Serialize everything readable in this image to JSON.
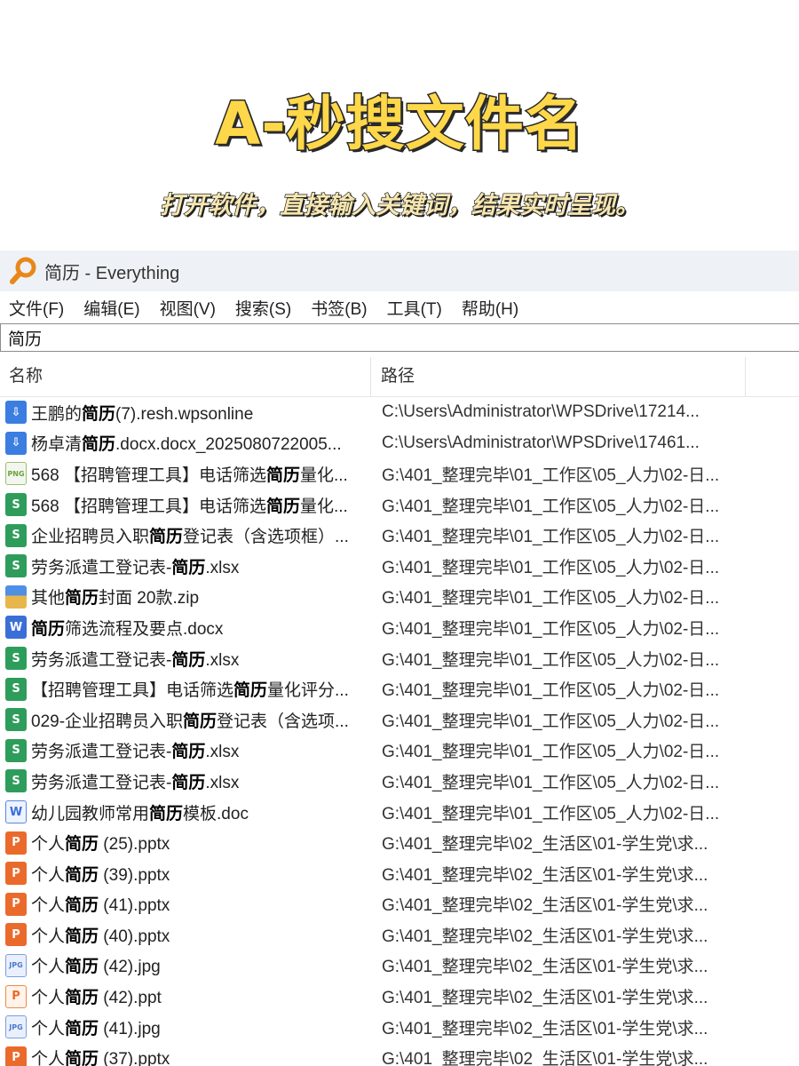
{
  "headline": "A-秒搜文件名",
  "subline": "打开软件，直接输入关键词，结果实时呈现。",
  "window": {
    "title": "简历 - Everything",
    "menu": [
      "文件(F)",
      "编辑(E)",
      "视图(V)",
      "搜索(S)",
      "书签(B)",
      "工具(T)",
      "帮助(H)"
    ],
    "search_value": "简历",
    "columns": {
      "name": "名称",
      "path": "路径"
    },
    "rows": [
      {
        "icon": "download-file-icon",
        "name": "王鹏的简历(7).resh.wpsonline",
        "path": "C:\\Users\\Administrator\\WPSDrive\\17214..."
      },
      {
        "icon": "download-file-icon",
        "name": "杨卓清简历.docx.docx_2025080722005...",
        "path": "C:\\Users\\Administrator\\WPSDrive\\17461..."
      },
      {
        "icon": "png-file-icon",
        "name": "568 【招聘管理工具】电话筛选简历量化...",
        "path": "G:\\401_整理完毕\\01_工作区\\05_人力\\02-日..."
      },
      {
        "icon": "xlsx-file-icon",
        "name": "568 【招聘管理工具】电话筛选简历量化...",
        "path": "G:\\401_整理完毕\\01_工作区\\05_人力\\02-日..."
      },
      {
        "icon": "xlsx-file-icon",
        "name": "企业招聘员入职简历登记表（含选项框）...",
        "path": "G:\\401_整理完毕\\01_工作区\\05_人力\\02-日..."
      },
      {
        "icon": "xlsx-file-icon",
        "name": "劳务派遣工登记表-简历.xlsx",
        "path": "G:\\401_整理完毕\\01_工作区\\05_人力\\02-日..."
      },
      {
        "icon": "zip-file-icon",
        "name": "其他简历封面 20款.zip",
        "path": "G:\\401_整理完毕\\01_工作区\\05_人力\\02-日..."
      },
      {
        "icon": "docx-file-icon",
        "name": "简历筛选流程及要点.docx",
        "path": "G:\\401_整理完毕\\01_工作区\\05_人力\\02-日..."
      },
      {
        "icon": "xlsx-file-icon",
        "name": "劳务派遣工登记表-简历.xlsx",
        "path": "G:\\401_整理完毕\\01_工作区\\05_人力\\02-日..."
      },
      {
        "icon": "xlsx-file-icon",
        "name": "【招聘管理工具】电话筛选简历量化评分...",
        "path": "G:\\401_整理完毕\\01_工作区\\05_人力\\02-日..."
      },
      {
        "icon": "xlsx-file-icon",
        "name": "029-企业招聘员入职简历登记表（含选项...",
        "path": "G:\\401_整理完毕\\01_工作区\\05_人力\\02-日..."
      },
      {
        "icon": "xlsx-file-icon",
        "name": "劳务派遣工登记表-简历.xlsx",
        "path": "G:\\401_整理完毕\\01_工作区\\05_人力\\02-日..."
      },
      {
        "icon": "xlsx-file-icon",
        "name": "劳务派遣工登记表-简历.xlsx",
        "path": "G:\\401_整理完毕\\01_工作区\\05_人力\\02-日..."
      },
      {
        "icon": "doc-file-icon",
        "name": "幼儿园教师常用简历模板.doc",
        "path": "G:\\401_整理完毕\\01_工作区\\05_人力\\02-日..."
      },
      {
        "icon": "pptx-file-icon",
        "name": "个人简历 (25).pptx",
        "path": "G:\\401_整理完毕\\02_生活区\\01-学生党\\求..."
      },
      {
        "icon": "pptx-file-icon",
        "name": "个人简历 (39).pptx",
        "path": "G:\\401_整理完毕\\02_生活区\\01-学生党\\求..."
      },
      {
        "icon": "pptx-file-icon",
        "name": "个人简历 (41).pptx",
        "path": "G:\\401_整理完毕\\02_生活区\\01-学生党\\求..."
      },
      {
        "icon": "pptx-file-icon",
        "name": "个人简历 (40).pptx",
        "path": "G:\\401_整理完毕\\02_生活区\\01-学生党\\求..."
      },
      {
        "icon": "jpg-file-icon",
        "name": "个人简历 (42).jpg",
        "path": "G:\\401_整理完毕\\02_生活区\\01-学生党\\求..."
      },
      {
        "icon": "ppt-file-icon",
        "name": "个人简历 (42).ppt",
        "path": "G:\\401_整理完毕\\02_生活区\\01-学生党\\求..."
      },
      {
        "icon": "jpg-file-icon",
        "name": "个人简历 (41).jpg",
        "path": "G:\\401_整理完毕\\02_生活区\\01-学生党\\求..."
      },
      {
        "icon": "pptx-file-icon",
        "name": "个人简历 (37).pptx",
        "path": "G:\\401_整理完毕\\02_生活区\\01-学生党\\求..."
      }
    ]
  },
  "colors": {
    "headline_fill": "#ffd84a",
    "headline_outline": "#2a2a2a",
    "titlebar_bg": "#eef2f6",
    "app_icon": "#e8871a"
  }
}
